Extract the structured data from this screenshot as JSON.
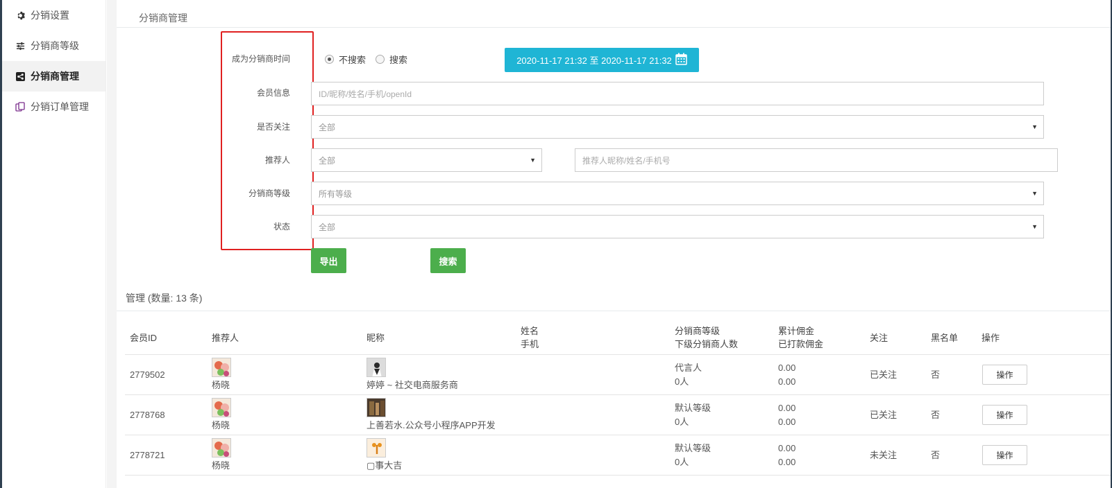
{
  "sidebar": {
    "items": [
      {
        "label": "分销设置",
        "icon": "gear-icon"
      },
      {
        "label": "分销商等级",
        "icon": "sliders-icon"
      },
      {
        "label": "分销商管理",
        "icon": "share-icon",
        "active": true
      },
      {
        "label": "分销订单管理",
        "icon": "orders-icon"
      }
    ]
  },
  "page": {
    "title": "分销商管理"
  },
  "filters": {
    "time_label": "成为分销商时间",
    "member_label": "会员信息",
    "follow_label": "是否关注",
    "referrer_label": "推荐人",
    "level_label": "分销商等级",
    "status_label": "状态",
    "radio_no_search": "不搜索",
    "radio_search": "搜索",
    "date_range": "2020-11-17 21:32 至 2020-11-17 21:32",
    "member_placeholder": "ID/昵称/姓名/手机/openId",
    "follow_value": "全部",
    "referrer_value": "全部",
    "referrer_placeholder": "推荐人昵称/姓名/手机号",
    "level_value": "所有等级",
    "status_value": "全部",
    "export_label": "导出",
    "search_label": "搜索"
  },
  "list": {
    "title": "管理 (数量: 13 条)",
    "headers": {
      "member_id": "会员ID",
      "referrer": "推荐人",
      "nickname": "昵称",
      "name": "姓名",
      "phone": "手机",
      "level": "分销商等级",
      "sub_count": "下级分销商人数",
      "total_commission": "累计佣金",
      "paid_commission": "已打款佣金",
      "follow": "关注",
      "blacklist": "黑名单",
      "action": "操作"
    },
    "rows": [
      {
        "id": "2779502",
        "referrer": "杨晓",
        "nickname": "婷婷 ~ 社交电商服务商",
        "level": "代言人",
        "sub_count": "0人",
        "total": "0.00",
        "paid": "0.00",
        "follow": "已关注",
        "blacklist": "否",
        "action": "操作"
      },
      {
        "id": "2778768",
        "referrer": "杨晓",
        "nickname": "上善若水.公众号小程序APP开发",
        "level": "默认等级",
        "sub_count": "0人",
        "total": "0.00",
        "paid": "0.00",
        "follow": "已关注",
        "blacklist": "否",
        "action": "操作"
      },
      {
        "id": "2778721",
        "referrer": "杨晓",
        "nickname": "▢事大吉",
        "level": "默认等级",
        "sub_count": "0人",
        "total": "0.00",
        "paid": "0.00",
        "follow": "未关注",
        "blacklist": "否",
        "action": "操作"
      }
    ]
  },
  "colors": {
    "accent": "#1fb5d5",
    "green": "#4cae4c",
    "highlight": "#e02020"
  }
}
